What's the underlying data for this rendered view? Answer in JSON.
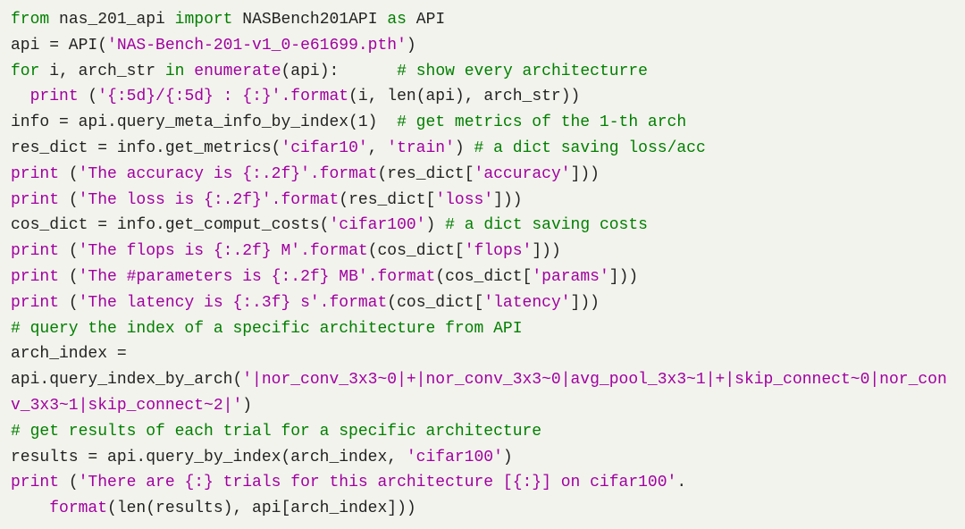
{
  "code": {
    "l1": {
      "kw_from": "from",
      "mod": "nas_201_api",
      "kw_import": "import",
      "cls": "NASBench201API",
      "kw_as": "as",
      "alias": "API"
    },
    "l2": {
      "lhs": "api = API(",
      "arg": "'NAS-Bench-201-v1_0-e61699.pth'",
      "rparen": ")"
    },
    "l3": {
      "kw_for": "for",
      "vars": "i, arch_str",
      "kw_in": "in",
      "iter": "enumerate",
      "obj": "(api):",
      "cmt": "# show every architecturre"
    },
    "l4": {
      "indent": "  ",
      "fn": "print",
      "open": " (",
      "s": "'{:5d}/{:5d} : {:}'",
      "fmt": ".format",
      "args": "(i, len(api), arch_str))"
    },
    "l5": {
      "lhs": "info = api.query_meta_info_by_index(1)",
      "cmt": "# get metrics of the 1-th arch"
    },
    "l6": {
      "lhs": "res_dict = info.get_metrics(",
      "a1": "'cifar10'",
      "comma": ", ",
      "a2": "'train'",
      "r": ")",
      "cmt": "# a dict saving loss/acc"
    },
    "l7": {
      "fn": "print",
      "open": " (",
      "s": "'The accuracy is {:.2f}'",
      "fmt": ".format",
      "args": "(res_dict[",
      "key": "'accuracy'",
      "end": "]))"
    },
    "l8": {
      "fn": "print",
      "open": " (",
      "s": "'The loss is {:.2f}'",
      "fmt": ".format",
      "args": "(res_dict[",
      "key": "'loss'",
      "end": "]))"
    },
    "l9": {
      "lhs": "cos_dict = info.get_comput_costs(",
      "a1": "'cifar100'",
      "r": ")",
      "cmt": "# a dict saving costs"
    },
    "l10": {
      "fn": "print",
      "open": " (",
      "s": "'The flops is {:.2f} M'",
      "fmt": ".format",
      "args": "(cos_dict[",
      "key": "'flops'",
      "end": "]))"
    },
    "l11": {
      "fn": "print",
      "open": " (",
      "s": "'The #parameters is {:.2f} MB'",
      "fmt": ".format",
      "args": "(cos_dict[",
      "key": "'params'",
      "end": "]))"
    },
    "l12": {
      "fn": "print",
      "open": " (",
      "s": "'The latency is {:.3f} s'",
      "fmt": ".format",
      "args": "(cos_dict[",
      "key": "'latency'",
      "end": "]))"
    },
    "l13": {
      "cmt": "# query the index of a specific architecture from API"
    },
    "l14": {
      "lhs": "arch_index = api.query_index_by_arch(",
      "s": "'|nor_conv_3x3~0|+|nor_conv_3x3~0|avg_pool_3x3~1|+|skip_connect~0|nor_conv_3x3~1|skip_connect~2|'",
      "r": ")"
    },
    "l15": {
      "cmt": "# get results of each trial for a specific architecture"
    },
    "l16": {
      "lhs": "results = api.query_by_index(arch_index, ",
      "a1": "'cifar100'",
      "r": ")"
    },
    "l17": {
      "fn": "print",
      "open": " (",
      "s": "'There are {:} trials for this architecture [{:}] on cifar100'",
      "dot": ".",
      "cont_indent": "    ",
      "fmt": "format",
      "args": "(len(results), api[arch_index]))"
    }
  }
}
